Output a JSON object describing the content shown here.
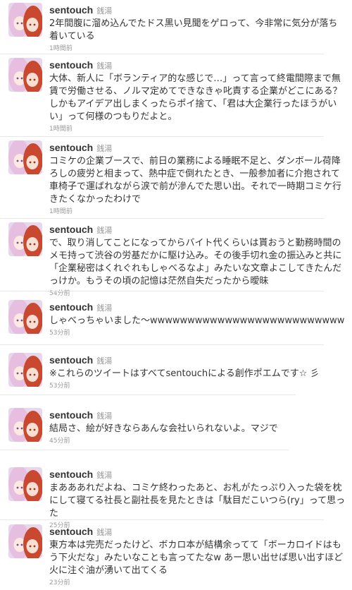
{
  "user": {
    "username": "sentouch",
    "fullname": "銭湯"
  },
  "tweets": [
    {
      "text": "2年間腹に溜め込んでたドス黒い見聞をゲロって、今非常に気分が落ち着いている",
      "time": "1時間前"
    },
    {
      "text": "大体、新人に「ボランティア的な感じで…」って言って終電間際まで無賃で労働させる、ノルマ定めてできなきゃ叱責する企業がどこにある？しかもアイデア出しまくったらポイ捨て、「君は大企業行ったほうがいい」って何様のつもりだよと。",
      "time": "1時間前"
    },
    {
      "text": "コミケの企業ブースで、前日の業務による睡眠不足と、ダンボール荷降ろしの疲労と相まって、熱中症で倒れたとき、一般参加者に介抱されて車椅子で運ばれながら涙で前が滲んでた思い出。それで一時期コミケ行きたくなかったわけで",
      "time": "1時間前"
    },
    {
      "text": "で、取り消してことになってからバイト代くらいは貰おうと勤務時間のメモ持って渋谷の労基だかに駆け込み。その後手切れ金の振込みと共に「企業秘密はくれぐれもしゃべるなよ」みたいな文章よこしてきたんだっけか。もうその頃の記憶は茫然自失だったから曖昧",
      "time": "54分前"
    },
    {
      "text": "しゃべっちゃいました〜wwwwwwwwwwwwwwwwwwwwwwwwww",
      "time": "53分前"
    },
    {
      "text": "※これらのツイートはすべてsentouchによる創作ポエムです☆ 彡",
      "time": "53分前"
    },
    {
      "text": "結局さ、絵が好きならあんな会社いられないよ。マジで",
      "time": "45分前"
    },
    {
      "text": "まあああれだよね、コミケ終わったあと、お札がたっぷり入った袋を枕にして寝てる社長と副社長を見たときは「駄目だこいつら(ry」って思った",
      "time": "25分前"
    },
    {
      "text": "東方本は完売だったけど、ボカロ本が結構余ってて「ボーカロイドはもう下火だな」みたいなことも言ってたなw あー思い出せば思い出すほど火に注ぐ油が湧いて出てくる",
      "time": "23分前"
    }
  ],
  "colors": {
    "text": "#333333",
    "meta": "#999999",
    "divider": "#e8e8e8"
  }
}
